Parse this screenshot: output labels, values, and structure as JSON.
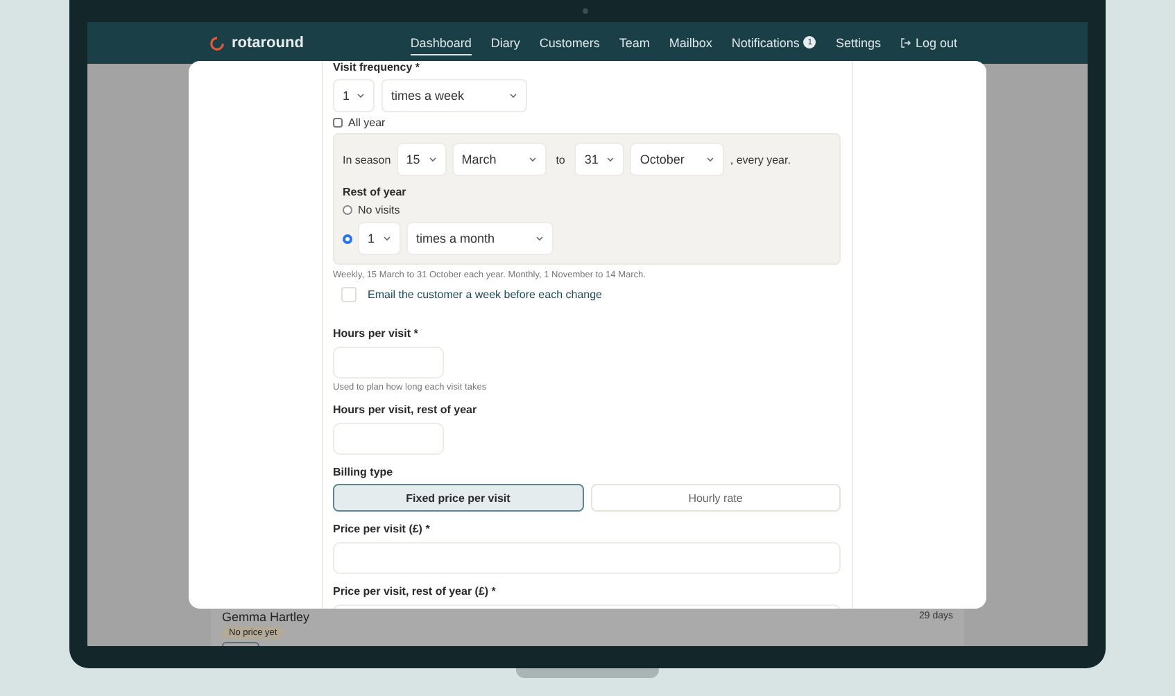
{
  "nav": {
    "brand": "rotaround",
    "items": [
      {
        "label": "Dashboard",
        "selected": true
      },
      {
        "label": "Diary",
        "selected": false
      },
      {
        "label": "Customers",
        "selected": false
      },
      {
        "label": "Team",
        "selected": false
      },
      {
        "label": "Mailbox",
        "selected": false
      },
      {
        "label": "Notifications",
        "selected": false,
        "badge": "1"
      },
      {
        "label": "Settings",
        "selected": false
      }
    ],
    "logout": "Log out"
  },
  "form": {
    "visit_frequency": {
      "label": "Visit frequency *",
      "count": "1",
      "unit": "times a week"
    },
    "all_year": {
      "label": "All year",
      "checked": false
    },
    "season": {
      "label": "In season",
      "from_day": "15",
      "from_month": "March",
      "to": "to",
      "to_day": "31",
      "to_month": "October",
      "suffix": ", every year."
    },
    "rest_of_year": {
      "title": "Rest of year",
      "options": [
        {
          "kind": "none",
          "label": "No visits",
          "selected": false
        },
        {
          "kind": "frequency",
          "count": "1",
          "unit": "times a month",
          "selected": true
        }
      ]
    },
    "summary": "Weekly, 15 March to 31 October each year. Monthly, 1 November to 14 March.",
    "email": {
      "label": "Email the customer a week before each change",
      "checked": false
    },
    "hours": {
      "label": "Hours per visit *",
      "hint": "Used to plan how long each visit takes"
    },
    "hours_rest": {
      "label": "Hours per visit, rest of year"
    },
    "billing": {
      "label": "Billing type",
      "options": [
        {
          "label": "Fixed price per visit",
          "selected": true
        },
        {
          "label": "Hourly rate",
          "selected": false
        }
      ]
    },
    "price": {
      "label": "Price per visit (£) *"
    },
    "price_rest": {
      "label": "Price per visit, rest of year (£) *"
    }
  },
  "background": {
    "name": "Gemma Hartley",
    "badge": "No price yet",
    "days": "29 days"
  }
}
